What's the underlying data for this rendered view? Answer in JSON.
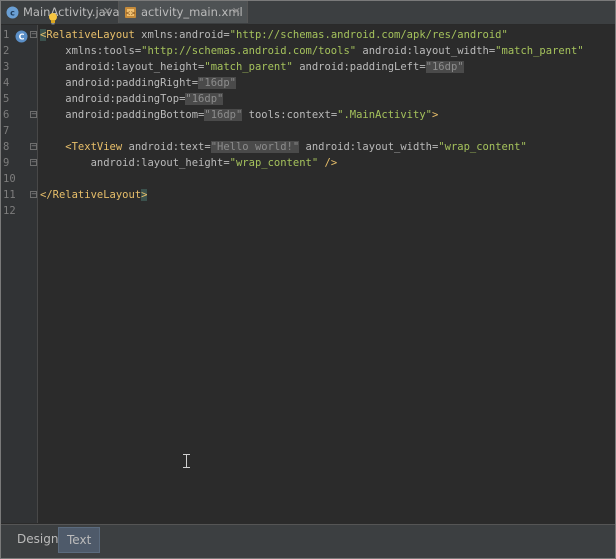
{
  "tabs": [
    {
      "label": "MainActivity.java",
      "icon": "class-c-icon",
      "active": false
    },
    {
      "label": "activity_main.xml",
      "icon": "xml-layout-icon",
      "active": true
    }
  ],
  "gutter": {
    "line_numbers": [
      "1",
      "2",
      "3",
      "4",
      "5",
      "6",
      "7",
      "8",
      "9",
      "10",
      "11",
      "12"
    ]
  },
  "code": {
    "l1": {
      "open": "<",
      "tag": "RelativeLayout",
      "attr": " xmlns:android=",
      "val": "\"http://schemas.android.com/apk/res/android\""
    },
    "l2": {
      "attr1": "    xmlns:tools=",
      "val1": "\"http://schemas.android.com/tools\"",
      "attr2": " android:layout_width=",
      "val2": "\"match_parent\""
    },
    "l3": {
      "attr1": "    android:layout_height=",
      "val1": "\"match_parent\"",
      "attr2": " android:paddingLeft=",
      "val2": "\"16dp\""
    },
    "l4": {
      "attr1": "    android:paddingRight=",
      "val1": "\"16dp\""
    },
    "l5": {
      "attr1": "    android:paddingTop=",
      "val1": "\"16dp\""
    },
    "l6": {
      "attr1": "    android:paddingBottom=",
      "val1": "\"16dp\"",
      "attr2": " tools:context=",
      "val2": "\".MainActivity\"",
      "close": ">"
    },
    "l8": {
      "tag": "    <TextView",
      "attr1": " android:text=",
      "val1": "\"Hello world!\"",
      "attr2": " android:layout_width=",
      "val2": "\"wrap_content\""
    },
    "l9": {
      "attr1": "        android:layout_height=",
      "val1": "\"wrap_content\"",
      "close": " />"
    },
    "l11": {
      "tag": "</RelativeLayout",
      "close": ">"
    }
  },
  "bottom_tabs": {
    "design": "Design",
    "text": "Text"
  },
  "colors": {
    "editor_bg": "#2b2b2b",
    "gutter_bg": "#313335",
    "tag": "#e8bf6a",
    "string": "#a5c25c",
    "attr": "#bababa",
    "active_bottom_tab": "#4e5a6a"
  }
}
